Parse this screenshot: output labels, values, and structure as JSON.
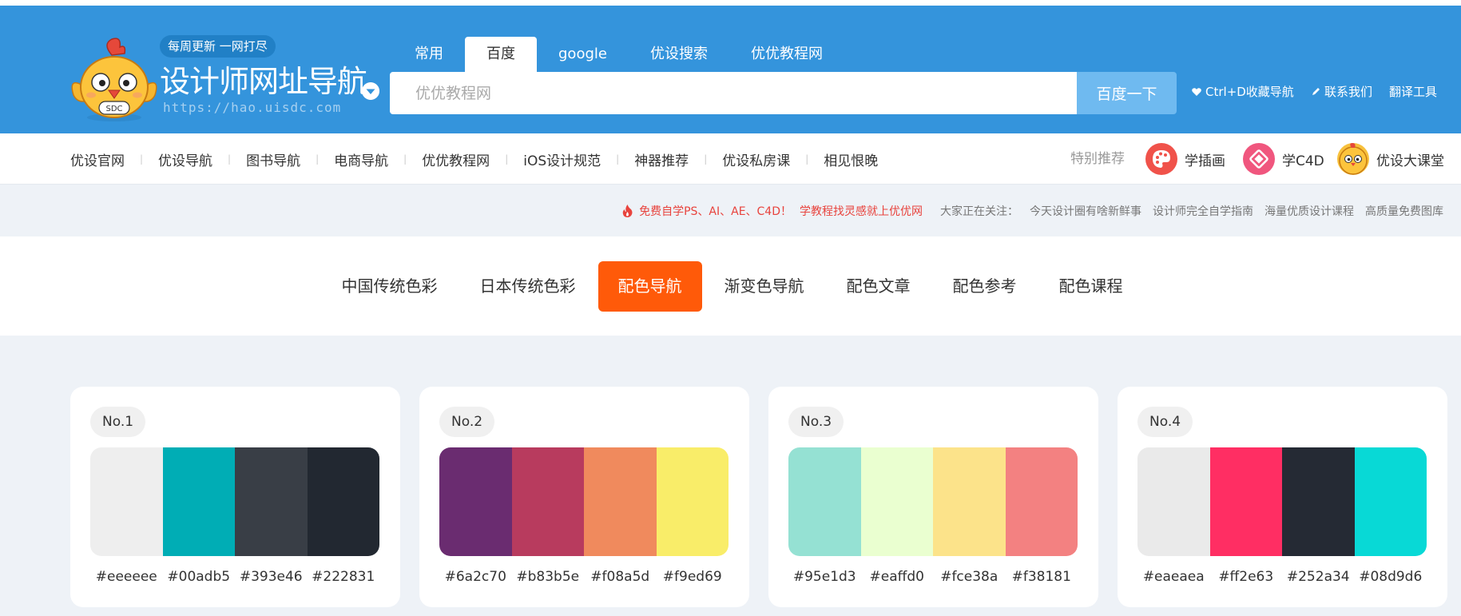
{
  "logo": {
    "bubble": "每周更新 一网打尽",
    "title": "设计师网址导航",
    "url": "https://hao.uisdc.com",
    "mascot_badge": "SDC"
  },
  "search": {
    "tabs": [
      "常用",
      "百度",
      "google",
      "优设搜索",
      "优优教程网"
    ],
    "active_tab": "百度",
    "placeholder": "优优教程网",
    "button": "百度一下"
  },
  "quick_links": {
    "bookmark": "Ctrl+D收藏导航",
    "contact": "联系我们",
    "translate": "翻译工具"
  },
  "nav": {
    "links": [
      "优设官网",
      "优设导航",
      "图书导航",
      "电商导航",
      "优优教程网",
      "iOS设计规范",
      "神器推荐",
      "优设私房课",
      "相见恨晚"
    ],
    "special_label": "特别推荐",
    "recommend": [
      {
        "label": "学插画",
        "icon": "palette-icon",
        "color": "#f0524a"
      },
      {
        "label": "学C4D",
        "icon": "film-icon",
        "color": "#f0567e"
      },
      {
        "label": "优设大课堂",
        "icon": "mascot-icon",
        "color": "#f8c13c"
      }
    ]
  },
  "notice": {
    "promo": "免费自学PS、AI、AE、C4D！",
    "promo_link": "学教程找灵感就上优优网",
    "label": "大家正在关注：",
    "items": [
      "今天设计圈有啥新鲜事",
      "设计师完全自学指南",
      "海量优质设计课程",
      "高质量免费图库"
    ]
  },
  "categories": {
    "items": [
      "中国传统色彩",
      "日本传统色彩",
      "配色导航",
      "渐变色导航",
      "配色文章",
      "配色参考",
      "配色课程"
    ],
    "active": "配色导航"
  },
  "palettes": [
    {
      "label": "No.1",
      "colors": [
        "#eeeeee",
        "#00adb5",
        "#393e46",
        "#222831"
      ]
    },
    {
      "label": "No.2",
      "colors": [
        "#6a2c70",
        "#b83b5e",
        "#f08a5d",
        "#f9ed69"
      ]
    },
    {
      "label": "No.3",
      "colors": [
        "#95e1d3",
        "#eaffd0",
        "#fce38a",
        "#f38181"
      ]
    },
    {
      "label": "No.4",
      "colors": [
        "#eaeaea",
        "#ff2e63",
        "#252a34",
        "#08d9d6"
      ]
    }
  ],
  "theme": {
    "header_blue": "#3494dc",
    "accent_orange": "#ff5a09",
    "notice_red": "#e8433d"
  }
}
